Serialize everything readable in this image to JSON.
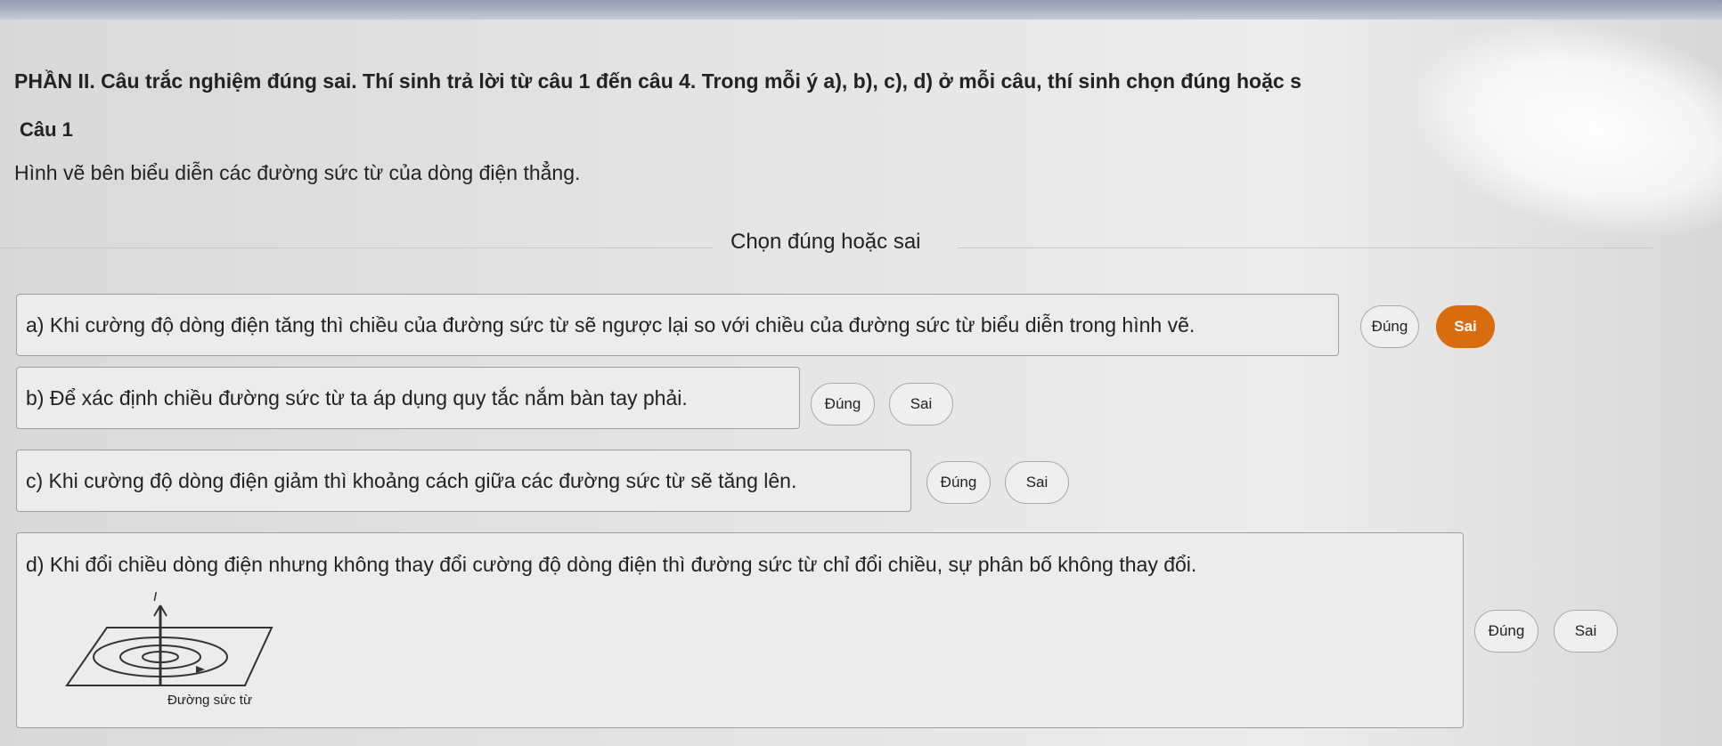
{
  "header": {
    "text": "PHẦN II. Câu trắc nghiệm đúng sai. Thí sinh trả lời từ câu 1 đến câu 4. Trong mỗi ý a), b), c), d) ở mỗi câu, thí sinh chọn đúng hoặc s"
  },
  "question": {
    "title": "Câu 1",
    "description": "Hình vẽ bên biểu diễn các đường sức từ của dòng điện thẳng."
  },
  "section_label": "Chọn đúng hoặc sai",
  "statements": [
    {
      "text": "a) Khi cường độ dòng điện tăng thì chiều của đường sức từ sẽ ngược lại so với chiều của đường sức từ biểu diễn trong hình vẽ.",
      "true_label": "Đúng",
      "false_label": "Sai",
      "selected": "Sai"
    },
    {
      "text": "b) Để xác định chiều đường sức từ ta áp dụng quy tắc nắm bàn tay phải.",
      "true_label": "Đúng",
      "false_label": "Sai",
      "selected": ""
    },
    {
      "text": "c) Khi cường độ dòng điện giảm thì khoảng cách giữa các đường sức từ sẽ tăng lên.",
      "true_label": "Đúng",
      "false_label": "Sai",
      "selected": ""
    },
    {
      "text": "d) Khi đổi chiều dòng điện nhưng không thay đổi cường độ dòng điện thì đường sức từ chỉ đổi chiều, sự phân bố không thay đổi.",
      "true_label": "Đúng",
      "false_label": "Sai",
      "selected": ""
    }
  ],
  "figure": {
    "current_label": "I",
    "field_line_label": "Đường sức từ"
  },
  "colors": {
    "selected": "#d86d10",
    "page_bg": "#e6e6e6"
  }
}
